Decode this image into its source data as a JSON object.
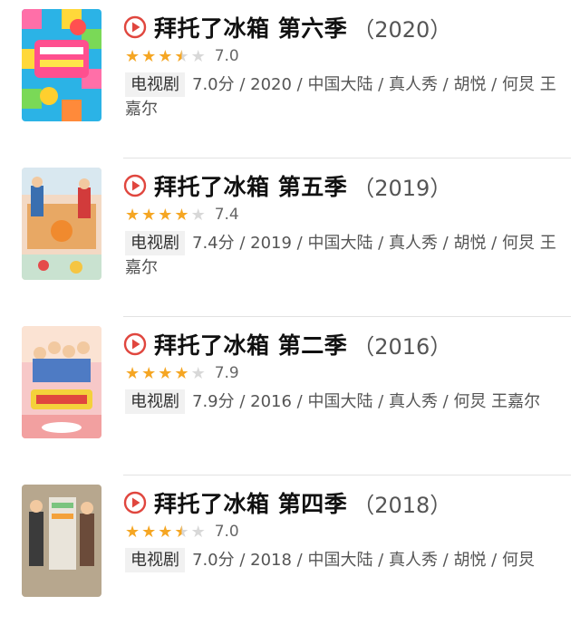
{
  "colors": {
    "play_icon": "#e0463e",
    "star_filled": "#f5a623",
    "star_empty": "#d8d8d8",
    "badge_bg": "#f1f1f1"
  },
  "icons": {
    "play": "play-circle-icon",
    "star": "star-icon"
  },
  "results": [
    {
      "title": "拜托了冰箱 第六季",
      "year": "（2020）",
      "stars": 3.5,
      "score": "7.0",
      "badge": "电视剧",
      "meta": "7.0分 / 2020 / 中国大陆 / 真人秀 / 胡悦 / 何炅 王嘉尔"
    },
    {
      "title": "拜托了冰箱 第五季",
      "year": "（2019）",
      "stars": 4,
      "score": "7.4",
      "badge": "电视剧",
      "meta": "7.4分 / 2019 / 中国大陆 / 真人秀 / 胡悦 / 何炅 王嘉尔"
    },
    {
      "title": "拜托了冰箱 第二季",
      "year": "（2016）",
      "stars": 4,
      "score": "7.9",
      "badge": "电视剧",
      "meta": "7.9分 / 2016 / 中国大陆 / 真人秀 / 何炅 王嘉尔"
    },
    {
      "title": "拜托了冰箱 第四季",
      "year": "（2018）",
      "stars": 3.5,
      "score": "7.0",
      "badge": "电视剧",
      "meta": "7.0分 / 2018 / 中国大陆 / 真人秀 / 胡悦 / 何炅"
    }
  ]
}
